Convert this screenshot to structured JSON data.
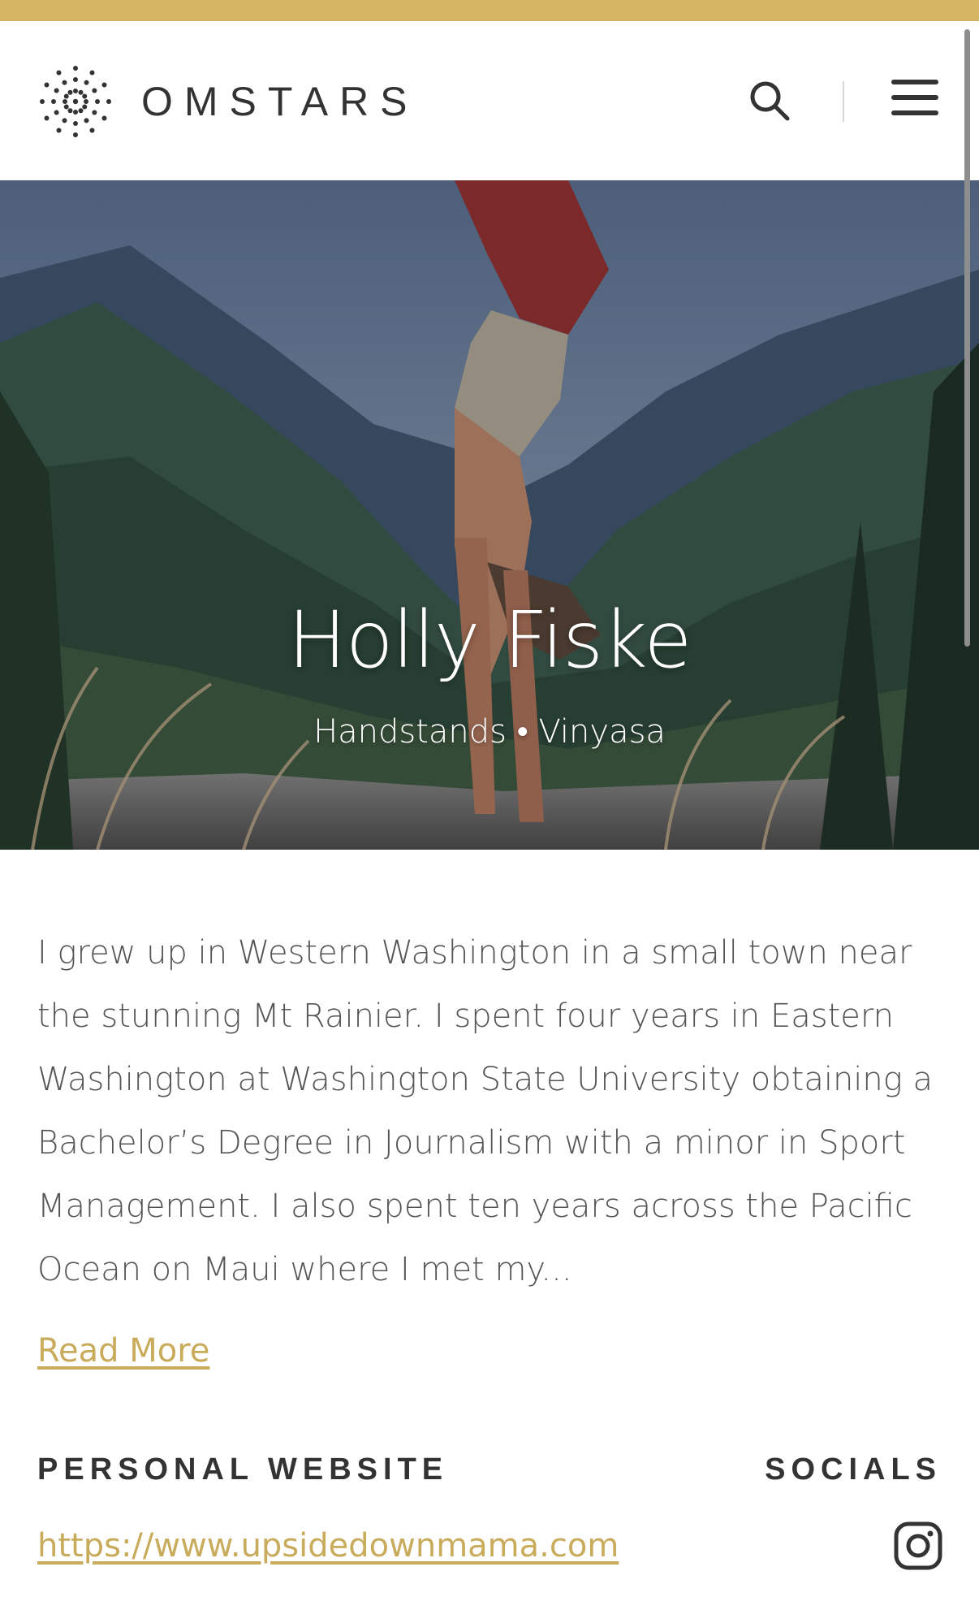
{
  "header": {
    "brand": "OMSTARS",
    "icons": {
      "logo": "omstars-dots-logo",
      "search": "search-icon",
      "menu": "hamburger-menu-icon"
    }
  },
  "hero": {
    "name": "Holly Fiske",
    "tags": "Handstands • Vinyasa",
    "image": "yoga-handstand-mountain-photo"
  },
  "bio": {
    "text": "I grew up in Western Washington in a small town near the stunning Mt Rainier. I spent four years in Eastern Washington at Washington State University obtaining a Bachelor’s Degree in Journalism with a minor in Sport Management. I also spent ten years across the Pacific Ocean on Maui where I met my...",
    "read_more": "Read More"
  },
  "links": {
    "website_label": "PERSONAL WEBSITE",
    "website_url": "https://www.upsidedownmama.com",
    "socials_label": "SOCIALS",
    "social_icons": [
      "instagram-icon"
    ]
  },
  "colors": {
    "accent": "#d4b664",
    "link": "#c9ab5c",
    "text": "#555555",
    "heading": "#333333"
  }
}
